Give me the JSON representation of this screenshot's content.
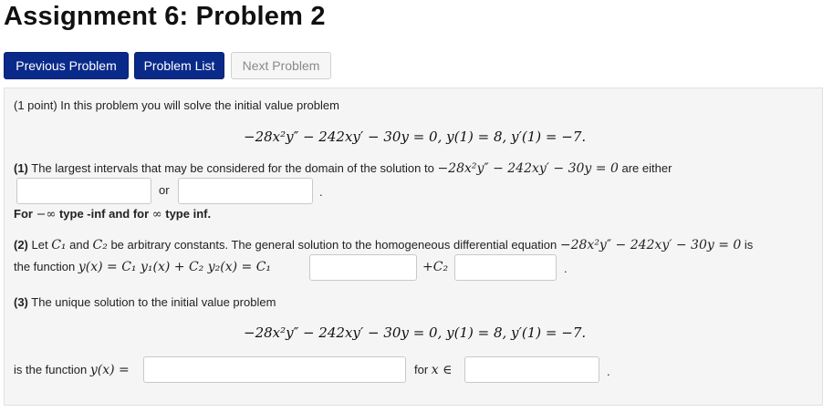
{
  "page_title": "Assignment 6: Problem 2",
  "nav": {
    "previous": "Previous Problem",
    "list": "Problem List",
    "next": "Next Problem"
  },
  "problem": {
    "intro": "(1 point) In this problem you will solve the initial value problem",
    "equation": "−28x²y″ − 242xy′ − 30y = 0,  y(1) = 8,  y′(1) = −7.",
    "part1_label": "(1)",
    "part1_text": "The largest intervals that may be considered for the domain of the solution to",
    "part1_eq": "−28x²y″ − 242xy′ − 30y = 0",
    "part1_tail": "are either",
    "or_text": "or",
    "dot": ".",
    "inf_note_for": "For",
    "inf_note_neg": "−∞",
    "inf_note_mid": "type -inf and for",
    "inf_note_pos": "∞",
    "inf_note_end": "type inf.",
    "part2_label": "(2)",
    "part2_text_a": "Let",
    "part2_c1": "C₁",
    "part2_and": "and",
    "part2_c2": "C₂",
    "part2_text_b": "be arbitrary constants. The general solution to the homogeneous differential equation",
    "part2_eq": "−28x²y″ − 242xy′ − 30y = 0",
    "part2_is": "is",
    "part2_line2_a": "the function",
    "part2_formula": "y(x) = C₁ y₁(x) + C₂ y₂(x) = C₁",
    "part2_plus_c2": "+C₂",
    "part3_label": "(3)",
    "part3_text": "The unique solution to the initial value problem",
    "part3_is_a": "is the function",
    "part3_yx": "y(x) =",
    "part3_for": "for",
    "part3_x_in": "x ∈"
  },
  "inputs": {
    "interval_1": "",
    "interval_2": "",
    "y1": "",
    "y2": "",
    "solution": "",
    "domain": ""
  },
  "colors": {
    "button_primary": "#0a2a8a",
    "panel_bg": "#f5f5f5"
  }
}
